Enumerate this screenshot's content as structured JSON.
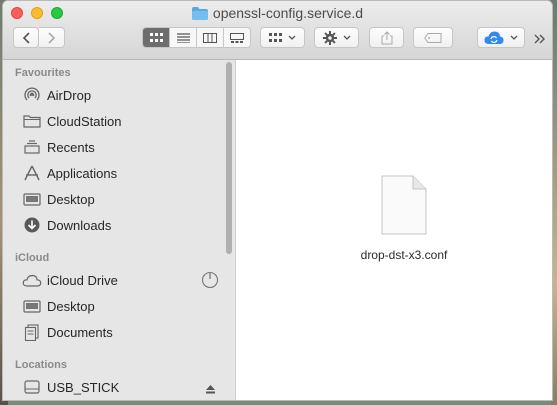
{
  "window": {
    "title": "openssl-config.service.d"
  },
  "toolbar": {
    "back": "back",
    "forward": "forward",
    "views": [
      "icon-view",
      "list-view",
      "column-view",
      "gallery-view"
    ],
    "active_view": 0
  },
  "sidebar": {
    "sections": [
      {
        "label": "Favourites",
        "items": [
          "AirDrop",
          "CloudStation",
          "Recents",
          "Applications",
          "Desktop",
          "Downloads"
        ]
      },
      {
        "label": "iCloud",
        "items": [
          "iCloud Drive",
          "Desktop",
          "Documents"
        ]
      },
      {
        "label": "Locations",
        "items": [
          "USB_STICK"
        ]
      }
    ]
  },
  "main": {
    "files": [
      {
        "name": "drop-dst-x3.conf"
      }
    ]
  },
  "colors": {
    "accent": "#2e8bf0",
    "sidebar": "#e6e6e6"
  }
}
